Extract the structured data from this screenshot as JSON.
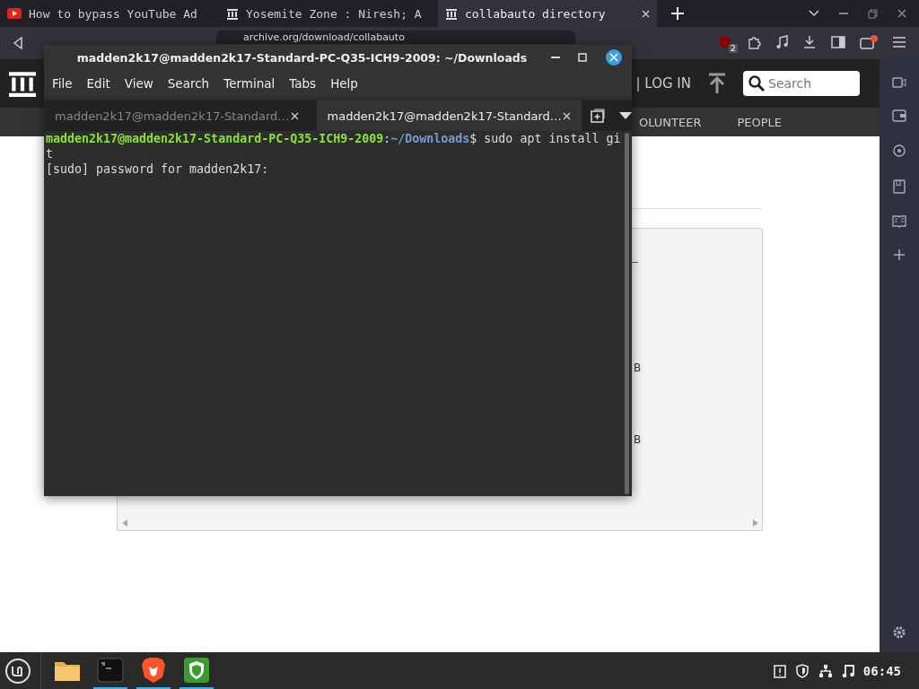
{
  "browser": {
    "tabs": [
      {
        "title": "How to bypass YouTube Ad",
        "selected": false
      },
      {
        "title": "Yosemite Zone : Niresh; A",
        "selected": false
      },
      {
        "title": "collabauto directory",
        "selected": true
      }
    ],
    "url": "archive.org/download/collabauto",
    "shield_badge": "2"
  },
  "site": {
    "login": "| LOG IN",
    "search": {
      "placeholder": "Search"
    },
    "nav": [
      "OLUNTEER",
      "PEOPLE"
    ],
    "fragments": [
      "B",
      "B"
    ]
  },
  "terminal": {
    "title": "madden2k17@madden2k17-Standard-PC-Q35-ICH9-2009: ~/Downloads",
    "menu": [
      "File",
      "Edit",
      "View",
      "Search",
      "Terminal",
      "Tabs",
      "Help"
    ],
    "tabs": [
      {
        "label": "madden2k17@madden2k17-Standard…",
        "selected": false
      },
      {
        "label": "madden2k17@madden2k17-Standard…",
        "selected": true
      }
    ],
    "prompt": {
      "user": "madden2k17@madden2k17-Standard-PC-Q35-ICH9-2009",
      "separator": ":",
      "path": "~/Downloads",
      "command": "$ sudo apt install gi",
      "wrap": "t"
    },
    "output": [
      "[sudo] password for madden2k17:"
    ]
  },
  "taskbar": {
    "apps": [
      {
        "kind": "files",
        "active": false
      },
      {
        "kind": "terminal",
        "active": true
      },
      {
        "kind": "brave",
        "active": true
      },
      {
        "kind": "shield",
        "active": true
      }
    ],
    "clock": "06:45"
  }
}
